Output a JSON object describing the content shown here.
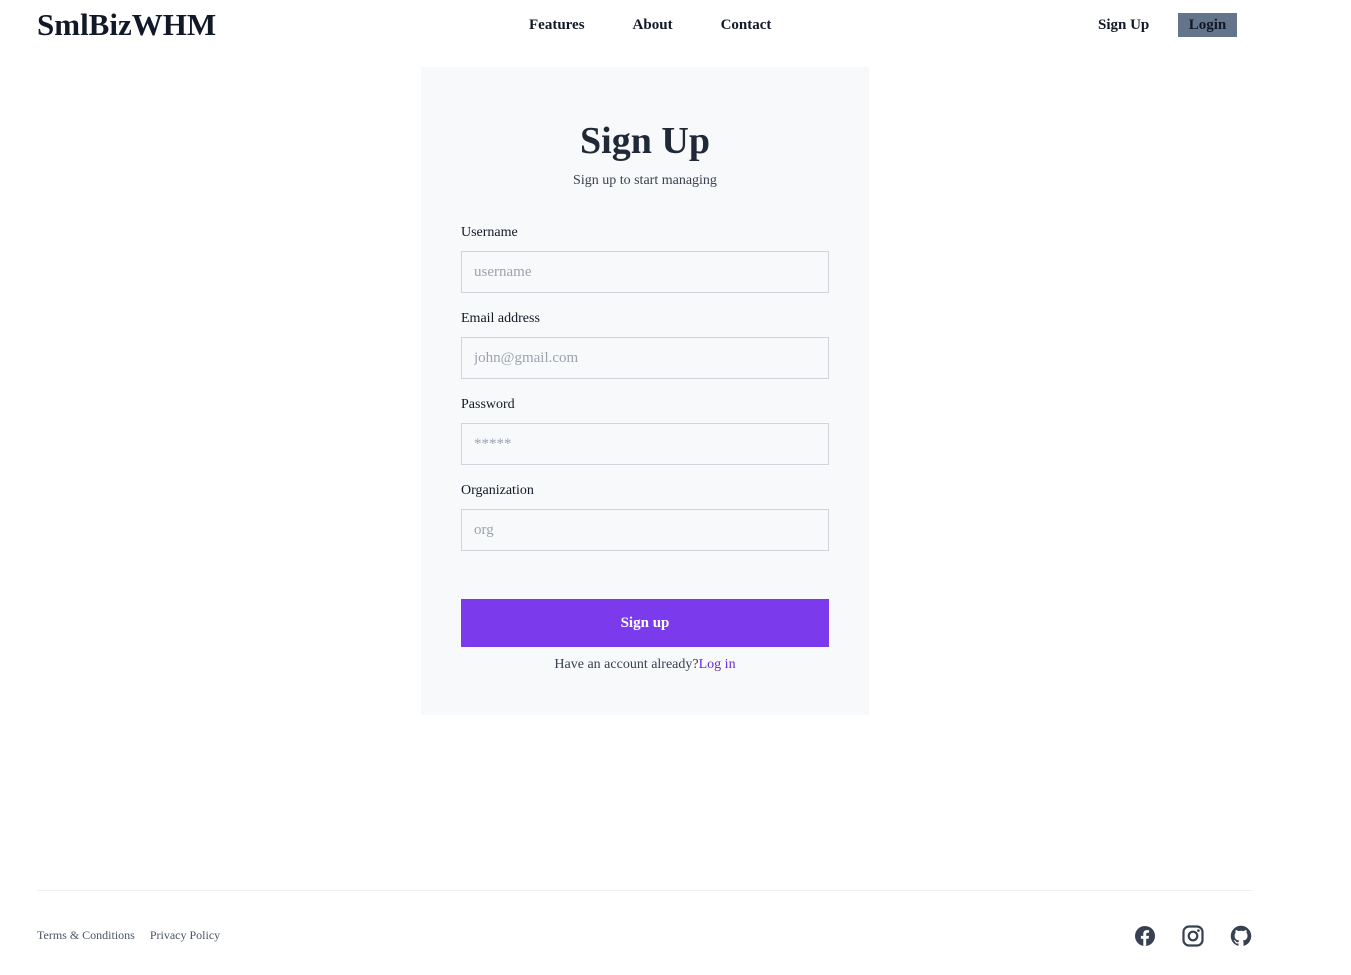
{
  "header": {
    "brand": "SmlBizWHM",
    "nav": [
      "Features",
      "About",
      "Contact"
    ],
    "signup_label": "Sign Up",
    "login_label": "Login"
  },
  "form": {
    "title": "Sign Up",
    "subtitle": "Sign up to start managing",
    "fields": [
      {
        "label": "Username",
        "placeholder": "username"
      },
      {
        "label": "Email address",
        "placeholder": "john@gmail.com"
      },
      {
        "label": "Password",
        "placeholder": "*****"
      },
      {
        "label": "Organization",
        "placeholder": "org"
      }
    ],
    "submit_label": "Sign up",
    "already_text": "Have an account already?",
    "login_link": "Log in"
  },
  "footer": {
    "links": [
      "Terms & Conditions",
      "Privacy Policy"
    ],
    "social_icons": [
      "facebook-icon",
      "instagram-icon",
      "github-icon"
    ]
  },
  "colors": {
    "accent": "#7c3aed",
    "link": "#6d28d9",
    "login_bg": "#64748b",
    "card_bg": "#f8f9fb"
  }
}
